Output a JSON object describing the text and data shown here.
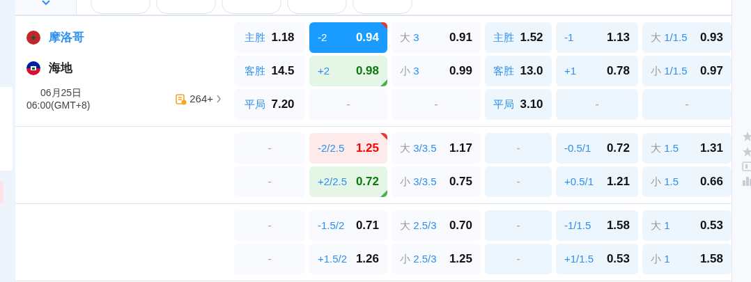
{
  "match": {
    "home": {
      "name": "摩洛哥",
      "highlighted": true
    },
    "away": {
      "name": "海地",
      "highlighted": false
    },
    "date": "06月25日",
    "time": "06:00(GMT+8)",
    "markets_count": "264+"
  },
  "groups": [
    {
      "rows": [
        [
          {
            "kind": "win",
            "label": "主胜",
            "odds": "1.18",
            "selected": false,
            "rising": false,
            "falling": false
          },
          {
            "kind": "handicap",
            "line": "-2",
            "odds": "0.94",
            "selected": true,
            "rising": true,
            "falling": false
          },
          {
            "kind": "total",
            "side": "大",
            "line": "3",
            "odds": "0.91",
            "selected": false,
            "rising": false,
            "falling": false
          },
          {
            "kind": "win",
            "label": "主胜",
            "odds": "1.52",
            "selected": false,
            "rising": false,
            "falling": false
          },
          {
            "kind": "handicap",
            "line": "-1",
            "odds": "1.13",
            "selected": false,
            "rising": false,
            "falling": false
          },
          {
            "kind": "total",
            "side": "大",
            "line": "1/1.5",
            "odds": "0.93",
            "selected": false,
            "rising": false,
            "falling": false
          }
        ],
        [
          {
            "kind": "win",
            "label": "客胜",
            "odds": "14.5",
            "selected": false,
            "rising": false,
            "falling": false
          },
          {
            "kind": "handicap",
            "line": "+2",
            "odds": "0.98",
            "selected": false,
            "rising": false,
            "falling": true
          },
          {
            "kind": "total",
            "side": "小",
            "line": "3",
            "odds": "0.99",
            "selected": false,
            "rising": false,
            "falling": false
          },
          {
            "kind": "win",
            "label": "客胜",
            "odds": "13.0",
            "selected": false,
            "rising": false,
            "falling": false
          },
          {
            "kind": "handicap",
            "line": "+1",
            "odds": "0.78",
            "selected": false,
            "rising": false,
            "falling": false
          },
          {
            "kind": "total",
            "side": "小",
            "line": "1/1.5",
            "odds": "0.97",
            "selected": false,
            "rising": false,
            "falling": false
          }
        ],
        [
          {
            "kind": "win",
            "label": "平局",
            "odds": "7.20",
            "selected": false,
            "rising": false,
            "falling": false
          },
          {
            "kind": "empty",
            "text": "-"
          },
          {
            "kind": "empty",
            "text": "-"
          },
          {
            "kind": "win",
            "label": "平局",
            "odds": "3.10",
            "selected": false,
            "rising": false,
            "falling": false
          },
          {
            "kind": "empty",
            "text": "-"
          },
          {
            "kind": "empty",
            "text": "-"
          }
        ]
      ]
    },
    {
      "rows": [
        [
          {
            "kind": "empty",
            "text": "-"
          },
          {
            "kind": "handicap",
            "line": "-2/2.5",
            "odds": "1.25",
            "selected": false,
            "rising": true,
            "falling": false
          },
          {
            "kind": "total",
            "side": "大",
            "line": "3/3.5",
            "odds": "1.17",
            "selected": false,
            "rising": false,
            "falling": false
          },
          {
            "kind": "empty",
            "text": "-"
          },
          {
            "kind": "handicap",
            "line": "-0.5/1",
            "odds": "0.72",
            "selected": false,
            "rising": false,
            "falling": false
          },
          {
            "kind": "total",
            "side": "大",
            "line": "1.5",
            "odds": "1.31",
            "selected": false,
            "rising": false,
            "falling": false
          }
        ],
        [
          {
            "kind": "empty",
            "text": "-"
          },
          {
            "kind": "handicap",
            "line": "+2/2.5",
            "odds": "0.72",
            "selected": false,
            "rising": false,
            "falling": true
          },
          {
            "kind": "total",
            "side": "小",
            "line": "3/3.5",
            "odds": "0.75",
            "selected": false,
            "rising": false,
            "falling": false
          },
          {
            "kind": "empty",
            "text": "-"
          },
          {
            "kind": "handicap",
            "line": "+0.5/1",
            "odds": "1.21",
            "selected": false,
            "rising": false,
            "falling": false
          },
          {
            "kind": "total",
            "side": "小",
            "line": "1.5",
            "odds": "0.66",
            "selected": false,
            "rising": false,
            "falling": false
          }
        ]
      ]
    },
    {
      "rows": [
        [
          {
            "kind": "empty",
            "text": "-"
          },
          {
            "kind": "handicap",
            "line": "-1.5/2",
            "odds": "0.71",
            "selected": false,
            "rising": false,
            "falling": false
          },
          {
            "kind": "total",
            "side": "大",
            "line": "2.5/3",
            "odds": "0.70",
            "selected": false,
            "rising": false,
            "falling": false
          },
          {
            "kind": "empty",
            "text": "-"
          },
          {
            "kind": "handicap",
            "line": "-1/1.5",
            "odds": "1.58",
            "selected": false,
            "rising": false,
            "falling": false
          },
          {
            "kind": "total",
            "side": "大",
            "line": "1",
            "odds": "0.53",
            "selected": false,
            "rising": false,
            "falling": false
          }
        ],
        [
          {
            "kind": "empty",
            "text": "-"
          },
          {
            "kind": "handicap",
            "line": "+1.5/2",
            "odds": "1.26",
            "selected": false,
            "rising": false,
            "falling": false
          },
          {
            "kind": "total",
            "side": "小",
            "line": "2.5/3",
            "odds": "1.25",
            "selected": false,
            "rising": false,
            "falling": false
          },
          {
            "kind": "empty",
            "text": "-"
          },
          {
            "kind": "handicap",
            "line": "+1/1.5",
            "odds": "0.53",
            "selected": false,
            "rising": false,
            "falling": false
          },
          {
            "kind": "total",
            "side": "小",
            "line": "1",
            "odds": "1.58",
            "selected": false,
            "rising": false,
            "falling": false
          }
        ]
      ]
    }
  ]
}
